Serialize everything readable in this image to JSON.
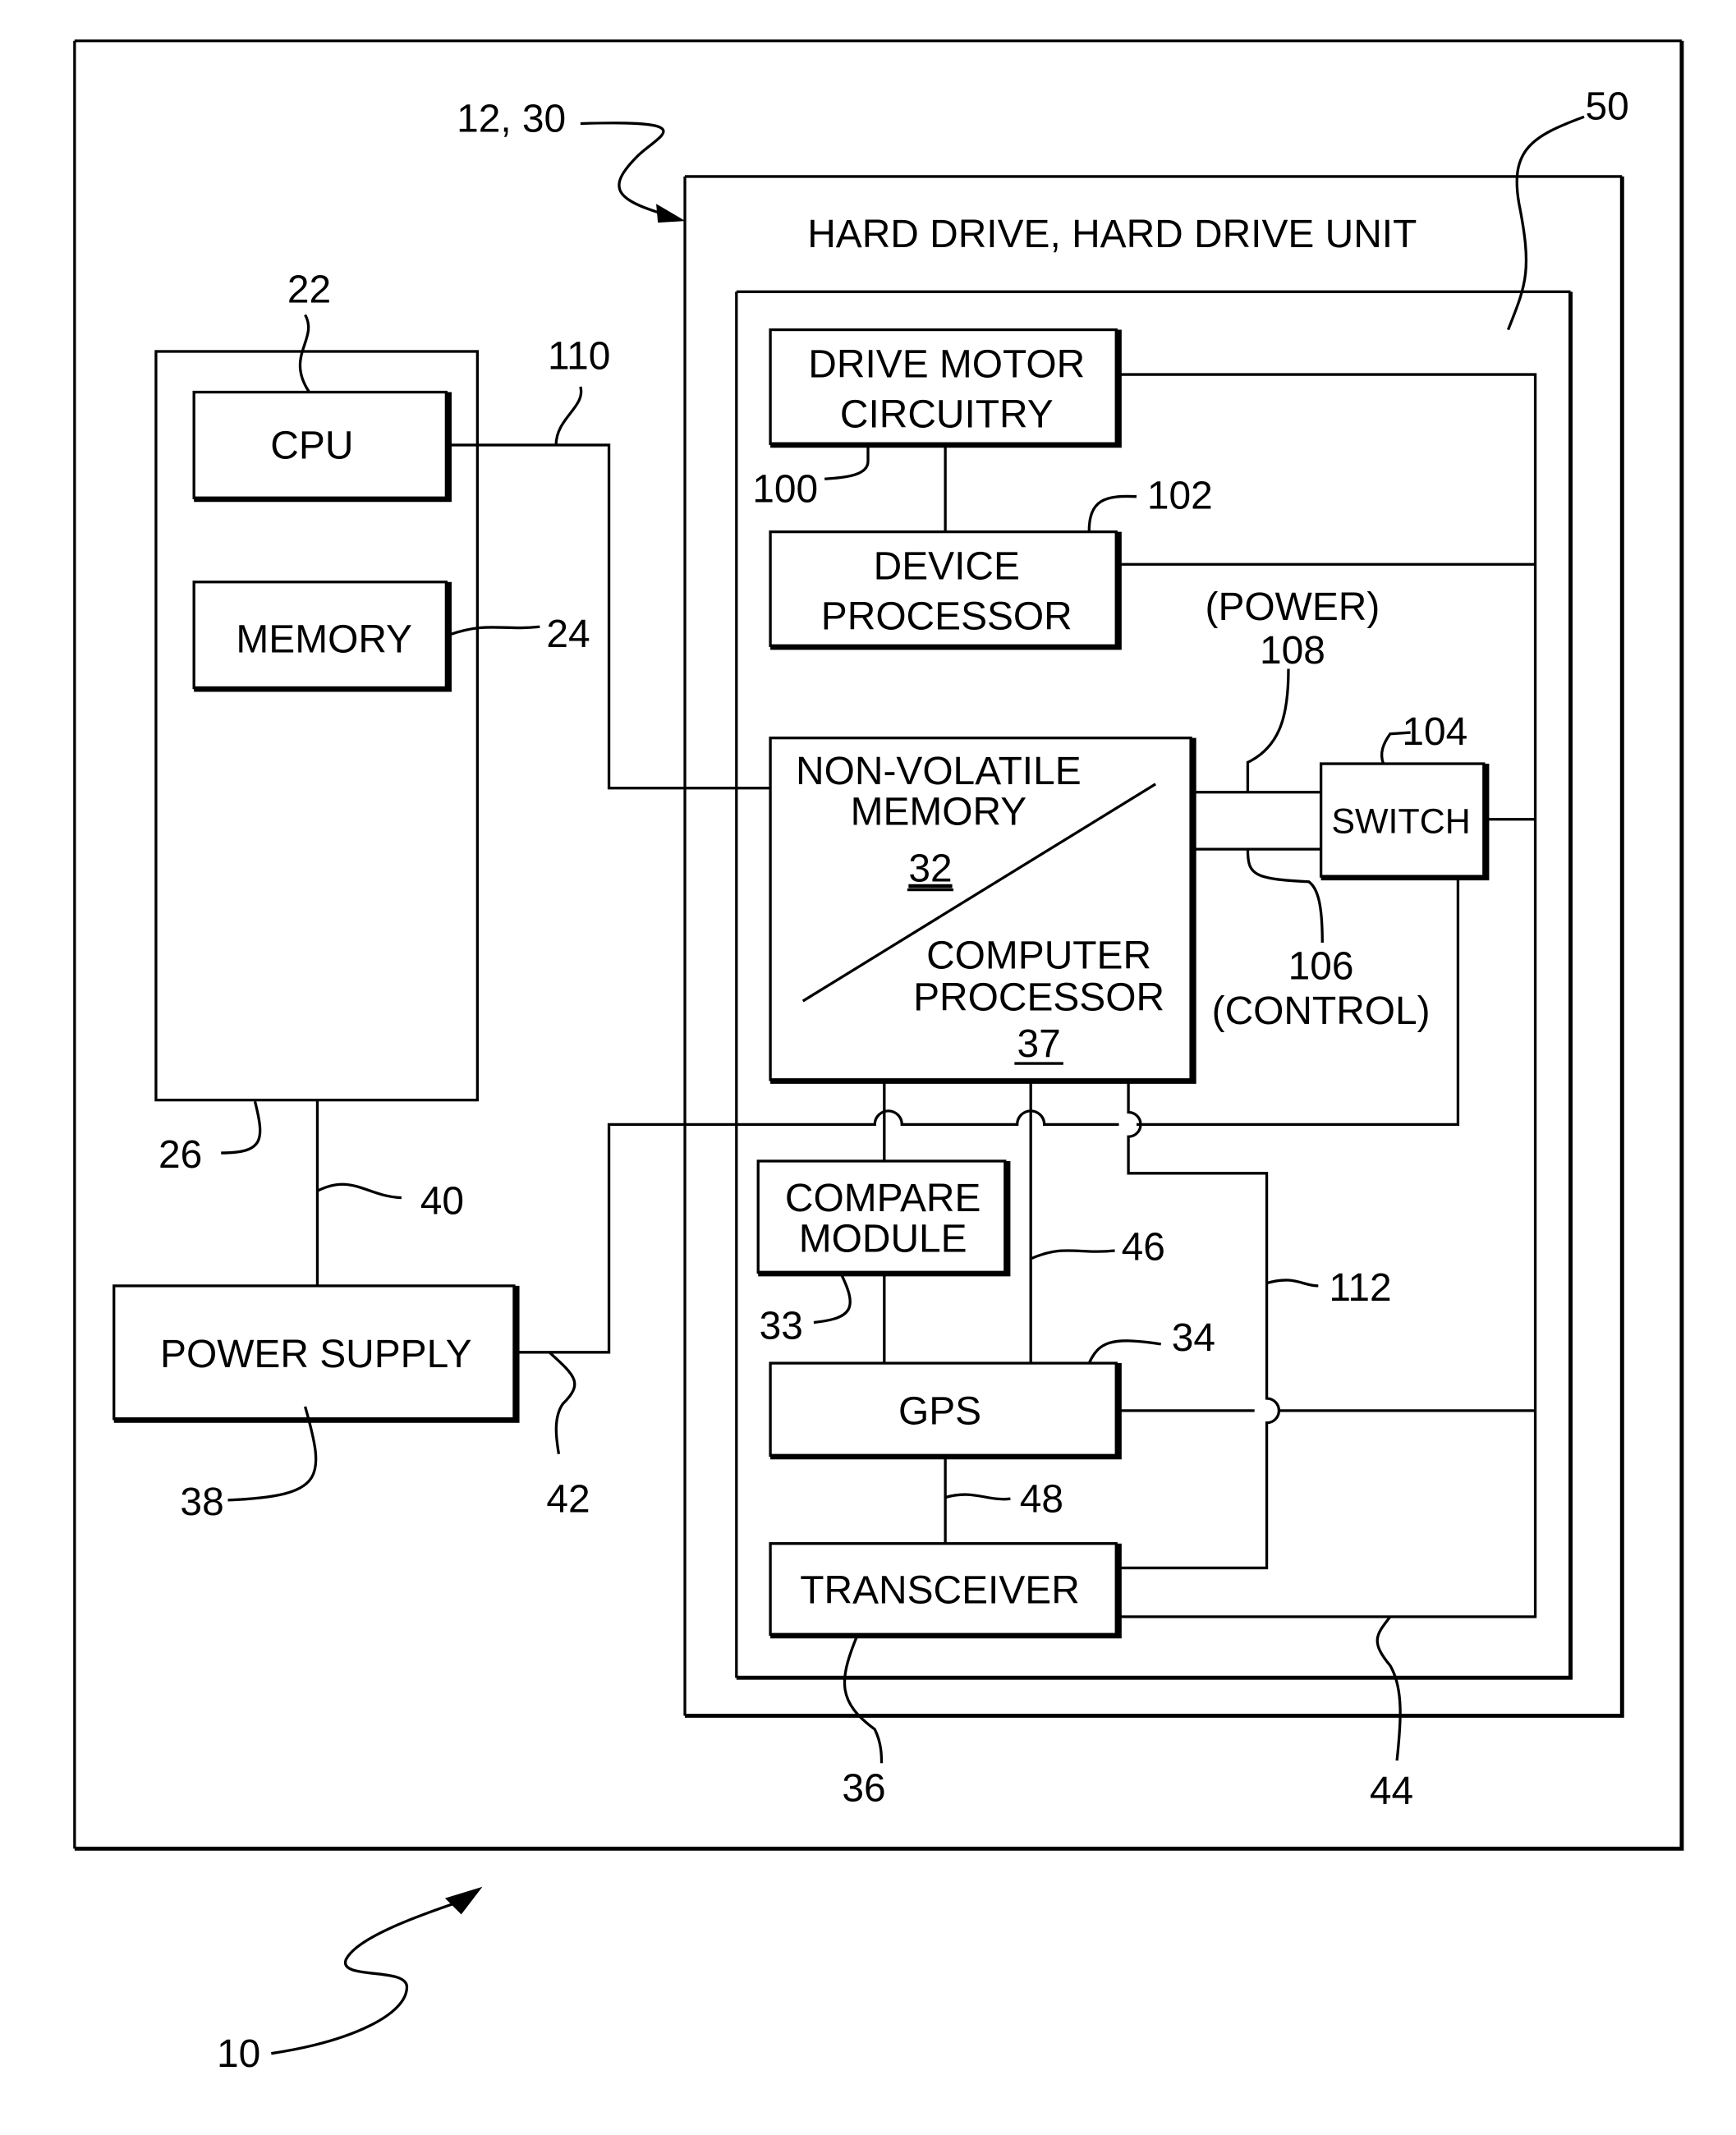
{
  "figure": {
    "system_ref": "10",
    "drive_ref": "12, 30",
    "drive_title": "HARD DRIVE, HARD DRIVE UNIT",
    "enclosure_ref": "50"
  },
  "host": {
    "housing_ref": "26",
    "cpu": {
      "label": "CPU",
      "ref": "22"
    },
    "memory": {
      "label": "MEMORY",
      "ref": "24"
    },
    "power_supply": {
      "label": "POWER SUPPLY",
      "ref": "38"
    },
    "bus_cpu_ref": "110",
    "bus_power_ref": "40",
    "bus_supply_ref": "42"
  },
  "drive": {
    "drive_motor": {
      "line1": "DRIVE MOTOR",
      "line2": "CIRCUITRY",
      "ref": "100"
    },
    "device_processor": {
      "line1": "DEVICE",
      "line2": "PROCESSOR",
      "ref": "102"
    },
    "nvm": {
      "line1": "NON-VOLATILE",
      "line2": "MEMORY",
      "ref": "32"
    },
    "computer_processor": {
      "line1": "COMPUTER",
      "line2": "PROCESSOR",
      "ref": "37"
    },
    "switch": {
      "label": "SWITCH",
      "ref": "104"
    },
    "power_line": {
      "label": "(POWER)",
      "ref": "108"
    },
    "control_line": {
      "label": "(CONTROL)",
      "ref": "106"
    },
    "compare_module": {
      "line1": "COMPARE",
      "line2": "MODULE",
      "ref": "33"
    },
    "gps": {
      "label": "GPS",
      "ref": "34"
    },
    "transceiver": {
      "label": "TRANSCEIVER",
      "ref": "36"
    },
    "line_46": "46",
    "line_48": "48",
    "line_112": "112",
    "line_44": "44"
  }
}
